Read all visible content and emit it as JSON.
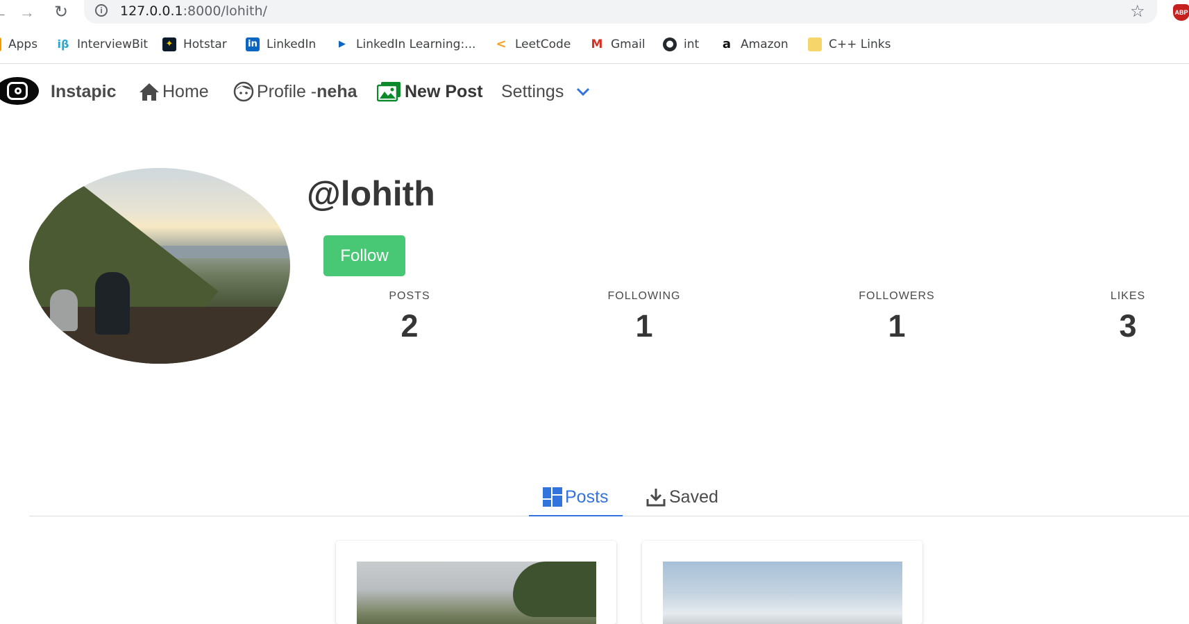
{
  "browser": {
    "url_host": "127.0.0.1",
    "url_rest": ":8000/lohith/",
    "bookmarks": [
      {
        "label": "Apps",
        "icon": "apps-grid-icon"
      },
      {
        "label": "InterviewBit",
        "icon": "interviewbit-icon"
      },
      {
        "label": "Hotstar",
        "icon": "hotstar-icon"
      },
      {
        "label": "LinkedIn",
        "icon": "linkedin-icon"
      },
      {
        "label": "LinkedIn Learning:...",
        "icon": "linkedin-learning-icon"
      },
      {
        "label": "LeetCode",
        "icon": "leetcode-icon"
      },
      {
        "label": "Gmail",
        "icon": "gmail-icon"
      },
      {
        "label": "int",
        "icon": "github-icon"
      },
      {
        "label": "Amazon",
        "icon": "amazon-icon"
      },
      {
        "label": "C++ Links",
        "icon": "folder-icon"
      }
    ]
  },
  "navbar": {
    "brand": "Instapic",
    "home": "Home",
    "profile_prefix": "Profile -",
    "profile_user": "neha",
    "new_post": "New Post",
    "settings": "Settings"
  },
  "profile": {
    "username": "@lohith",
    "follow_label": "Follow",
    "stats": {
      "posts_label": "POSTS",
      "posts_value": "2",
      "following_label": "FOLLOWING",
      "following_value": "1",
      "followers_label": "FOLLOWERS",
      "followers_value": "1",
      "likes_label": "LIKES",
      "likes_value": "3"
    }
  },
  "tabs": {
    "posts": "Posts",
    "saved": "Saved",
    "active": "Posts"
  },
  "colors": {
    "accent": "#3273dc",
    "follow_button": "#48c774",
    "new_post_icon": "#0a8a2a"
  }
}
